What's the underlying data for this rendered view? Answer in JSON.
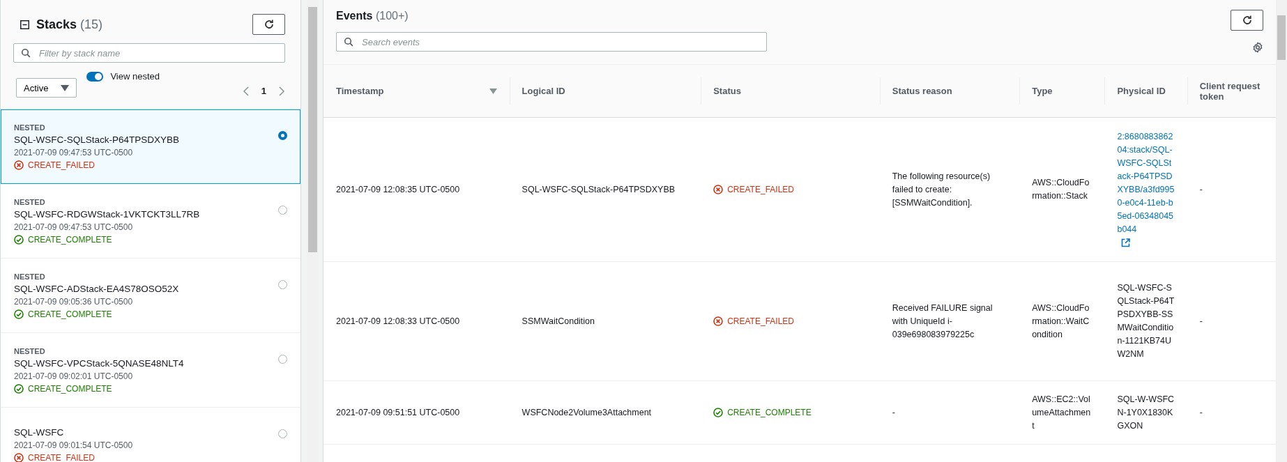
{
  "stacks_panel": {
    "title": "Stacks",
    "count": "(15)",
    "filter": {
      "placeholder": "Filter by stack name"
    },
    "status_filter": "Active",
    "view_nested": {
      "label": "View nested",
      "on": true
    },
    "page": "1",
    "items": [
      {
        "badge": "NESTED",
        "name": "SQL-WSFC-SQLStack-P64TPSDXYBB",
        "time": "2021-07-09 09:47:53 UTC-0500",
        "status": "CREATE_FAILED",
        "kind": "failed",
        "selected": true
      },
      {
        "badge": "NESTED",
        "name": "SQL-WSFC-RDGWStack-1VKTCKT3LL7RB",
        "time": "2021-07-09 09:47:53 UTC-0500",
        "status": "CREATE_COMPLETE",
        "kind": "complete",
        "selected": false
      },
      {
        "badge": "NESTED",
        "name": "SQL-WSFC-ADStack-EA4S78OSO52X",
        "time": "2021-07-09 09:05:36 UTC-0500",
        "status": "CREATE_COMPLETE",
        "kind": "complete",
        "selected": false
      },
      {
        "badge": "NESTED",
        "name": "SQL-WSFC-VPCStack-5QNASE48NLT4",
        "time": "2021-07-09 09:02:01 UTC-0500",
        "status": "CREATE_COMPLETE",
        "kind": "complete",
        "selected": false
      },
      {
        "name": "SQL-WSFC",
        "time": "2021-07-09 09:01:54 UTC-0500",
        "status": "CREATE_FAILED",
        "kind": "failed",
        "selected": false
      }
    ]
  },
  "events_panel": {
    "title": "Events",
    "count": "(100+)",
    "search": {
      "placeholder": "Search events"
    },
    "table": {
      "columns": [
        "Timestamp",
        "Logical ID",
        "Status",
        "Status reason",
        "Type",
        "Physical ID",
        "Client request token"
      ],
      "rows": [
        {
          "timestamp": "2021-07-09 12:08:35 UTC-0500",
          "logical_id": "SQL-WSFC-SQLStack-P64TPSDXYBB",
          "status": "CREATE_FAILED",
          "kind": "failed",
          "status_reason": "The following resource(s) failed to create: [SSMWaitCondition].",
          "type": "AWS::CloudFormation::Stack",
          "physical_id": "2:868088386204:stack/SQL-WSFC-SQLStack-P64TPSDXYBB/a3fd9950-e0c4-11eb-b5ed-06348045b044",
          "physical_id_link": true,
          "client_request_token": "-"
        },
        {
          "timestamp": "2021-07-09 12:08:33 UTC-0500",
          "logical_id": "SSMWaitCondition",
          "status": "CREATE_FAILED",
          "kind": "failed",
          "status_reason": "Received FAILURE signal with UniqueId i-039e698083979225c",
          "type": "AWS::CloudFormation::WaitCondition",
          "physical_id": "SQL-WSFC-SQLStack-P64TPSDXYBB-SSMWaitCondition-1121KB74UW2NM",
          "physical_id_link": false,
          "client_request_token": "-"
        },
        {
          "timestamp": "2021-07-09 09:51:51 UTC-0500",
          "logical_id": "WSFCNode2Volume3Attachment",
          "status": "CREATE_COMPLETE",
          "kind": "complete",
          "status_reason": "-",
          "type": "AWS::EC2::VolumeAttachment",
          "physical_id": "SQL-W-WSFCN-1Y0X1830KGXON",
          "physical_id_link": false,
          "client_request_token": "-"
        }
      ]
    }
  }
}
